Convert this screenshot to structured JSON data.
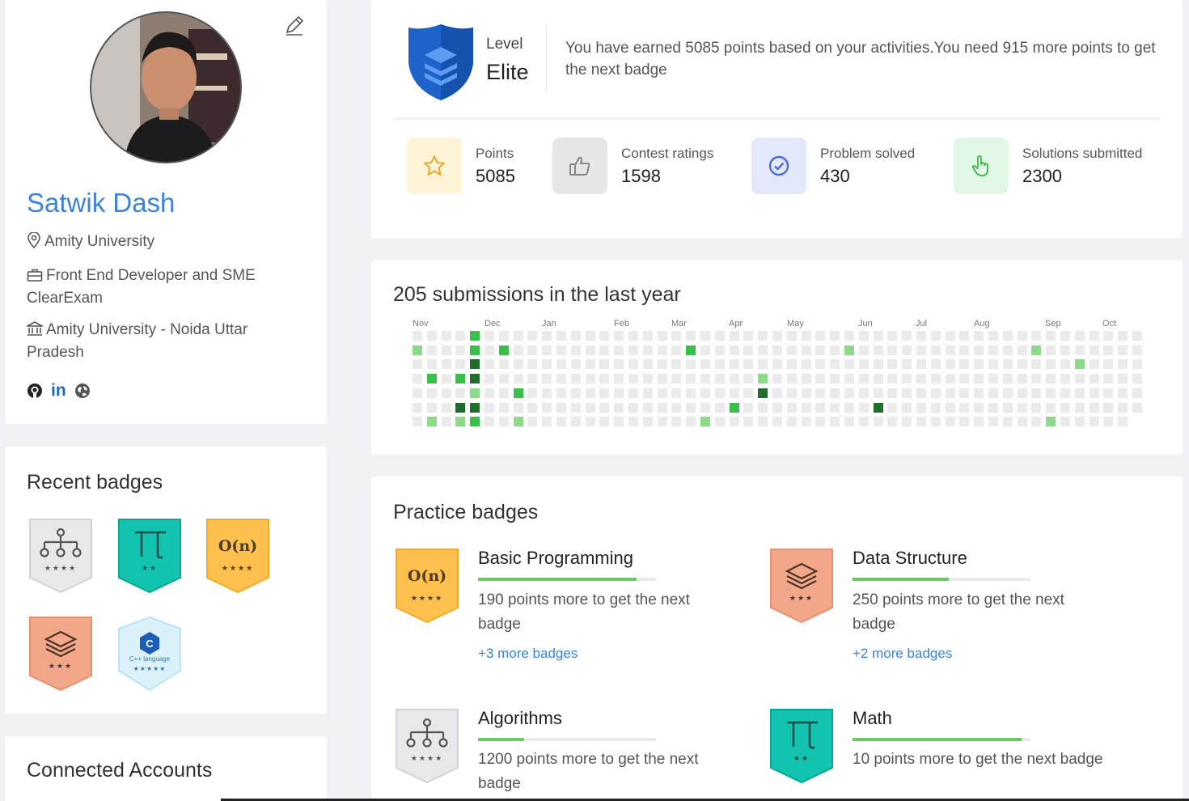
{
  "profile": {
    "name": "Satwik Dash",
    "location": "Amity University",
    "job": "Front End Developer and SME ClearExam",
    "institution": "Amity University - Noida Uttar Pradesh",
    "socials": [
      "github-icon",
      "linkedin-icon",
      "globe-icon"
    ],
    "linkedin_text": "in"
  },
  "recent_badges": {
    "title": "Recent badges",
    "items": [
      {
        "name": "algorithms",
        "stars": "★★★★"
      },
      {
        "name": "math",
        "stars": "★★"
      },
      {
        "name": "basic-programming",
        "text": "O(n)",
        "stars": "★★★★"
      },
      {
        "name": "data-structure",
        "stars": "★★★"
      },
      {
        "name": "cpp-language",
        "text": "C++ language",
        "stars": "★★★★★"
      }
    ]
  },
  "connected_accounts": {
    "title": "Connected Accounts"
  },
  "level": {
    "label": "Level",
    "value": "Elite",
    "description": "You have earned 5085 points based on your activities.You need 915 more points to get the next badge"
  },
  "stats": [
    {
      "label": "Points",
      "value": "5085",
      "icon": "star-icon",
      "bg": "#fff4d6"
    },
    {
      "label": "Contest ratings",
      "value": "1598",
      "icon": "thumbs-up-icon",
      "bg": "#e6e6e8"
    },
    {
      "label": "Problem solved",
      "value": "430",
      "icon": "check-circle-icon",
      "bg": "#e4e8fb"
    },
    {
      "label": "Solutions submitted",
      "value": "2300",
      "icon": "hand-pointer-icon",
      "bg": "#e3f7e6"
    }
  ],
  "submissions": {
    "title": "205 submissions in the last year",
    "months": [
      "Nov",
      "Dec",
      "Jan",
      "Feb",
      "Mar",
      "Apr",
      "May",
      "Jun",
      "Jul",
      "Aug",
      "Sep",
      "Oct"
    ],
    "colors": {
      "empty": "#ebebeb",
      "light": "#8ed98a",
      "medium": "#3bbf4b",
      "dark": "#1f6e2c"
    }
  },
  "practice": {
    "title": "Practice badges",
    "items": [
      {
        "title": "Basic Programming",
        "progress": 0.89,
        "desc": "190 points more to get the next badge",
        "more": "+3 more badges",
        "badge_text": "O(n)",
        "stars": "★★★★"
      },
      {
        "title": "Data Structure",
        "progress": 0.54,
        "desc": "250 points more to get the next badge",
        "more": "+2 more badges",
        "stars": "★★★"
      },
      {
        "title": "Algorithms",
        "progress": 0.26,
        "desc": "1200 points more to get the next badge",
        "more": "",
        "stars": "★★★★"
      },
      {
        "title": "Math",
        "progress": 0.95,
        "desc": "10 points more to get the next badge",
        "more": "",
        "stars": "★★"
      }
    ]
  }
}
